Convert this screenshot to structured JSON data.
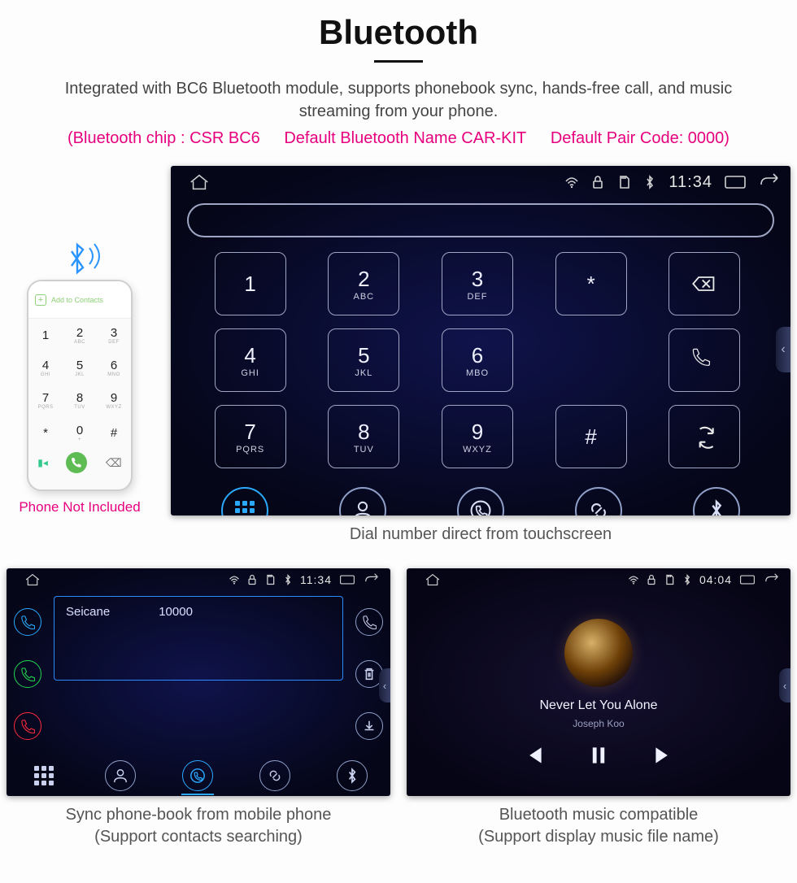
{
  "header": {
    "title": "Bluetooth",
    "subtitle": "Integrated with BC6 Bluetooth module, supports phonebook sync, hands-free call, and music streaming from your phone.",
    "chip_specs": {
      "chip": "(Bluetooth chip : CSR BC6",
      "name": "Default Bluetooth Name CAR-KIT",
      "pair": "Default Pair Code: 0000)"
    }
  },
  "phone": {
    "add_to_contacts": "Add to Contacts",
    "note": "Phone Not Included",
    "keys": [
      {
        "d": "1",
        "l": ""
      },
      {
        "d": "2",
        "l": "ABC"
      },
      {
        "d": "3",
        "l": "DEF"
      },
      {
        "d": "4",
        "l": "GHI"
      },
      {
        "d": "5",
        "l": "JKL"
      },
      {
        "d": "6",
        "l": "MNO"
      },
      {
        "d": "7",
        "l": "PQRS"
      },
      {
        "d": "8",
        "l": "TUV"
      },
      {
        "d": "9",
        "l": "WXYZ"
      },
      {
        "d": "*",
        "l": ""
      },
      {
        "d": "0",
        "l": "+"
      },
      {
        "d": "#",
        "l": ""
      }
    ]
  },
  "main_screen": {
    "time": "11:34",
    "keys": [
      {
        "d": "1",
        "l": ""
      },
      {
        "d": "2",
        "l": "ABC"
      },
      {
        "d": "3",
        "l": "DEF"
      },
      {
        "d": "*",
        "l": ""
      },
      {
        "icon": "backspace"
      },
      {
        "d": "4",
        "l": "GHI"
      },
      {
        "d": "5",
        "l": "JKL"
      },
      {
        "d": "6",
        "l": "MBO"
      },
      {
        "icon": "none"
      },
      {
        "icon": "call",
        "green": true
      },
      {
        "d": "7",
        "l": "PQRS"
      },
      {
        "d": "8",
        "l": "TUV"
      },
      {
        "d": "9",
        "l": "WXYZ"
      },
      {
        "d": "#",
        "l": ""
      },
      {
        "icon": "swap"
      }
    ],
    "caption": "Dial number direct from touchscreen"
  },
  "phonebook_screen": {
    "time": "11:34",
    "contact": {
      "name": "Seicane",
      "number": "10000"
    },
    "caption1": "Sync phone-book from mobile phone",
    "caption2": "(Support contacts searching)"
  },
  "music_screen": {
    "time": "04:04",
    "track": "Never Let You Alone",
    "artist": "Joseph Koo",
    "caption1": "Bluetooth music compatible",
    "caption2": "(Support display music file name)"
  }
}
